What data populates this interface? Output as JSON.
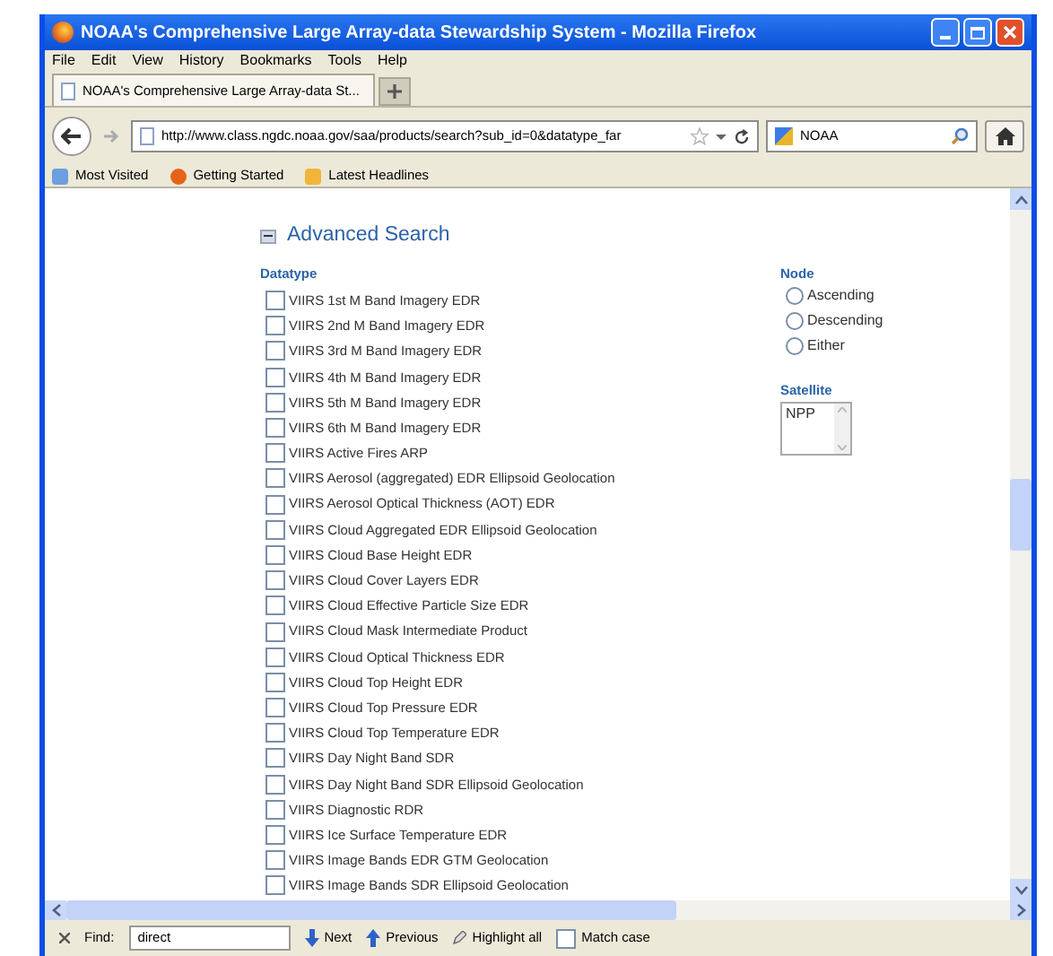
{
  "window": {
    "title": "NOAA's Comprehensive Large Array-data Stewardship System - Mozilla Firefox"
  },
  "menu": [
    "File",
    "Edit",
    "View",
    "History",
    "Bookmarks",
    "Tools",
    "Help"
  ],
  "tabs": [
    {
      "label": "NOAA's Comprehensive Large Array-data St...",
      "selected": true
    }
  ],
  "address": {
    "value": "http://www.class.ngdc.noaa.gov/saa/products/search?sub_id=0&datatype_far"
  },
  "search": {
    "value": "NOAA"
  },
  "bookmarks": [
    "Most Visited",
    "Getting Started",
    "Latest Headlines"
  ],
  "page": {
    "heading": "Advanced Search",
    "datatype": {
      "label": "Datatype",
      "items": [
        {
          "label": "VIIRS 1st M Band Imagery EDR",
          "checked": false
        },
        {
          "label": "VIIRS 2nd M Band Imagery EDR",
          "checked": false
        },
        {
          "label": "VIIRS 3rd M Band Imagery EDR",
          "checked": false
        },
        {
          "label": "VIIRS 4th M Band Imagery EDR",
          "checked": false
        },
        {
          "label": "VIIRS 5th M Band Imagery EDR",
          "checked": false
        },
        {
          "label": "VIIRS 6th M Band Imagery EDR",
          "checked": false
        },
        {
          "label": "VIIRS Active Fires ARP",
          "checked": false
        },
        {
          "label": "VIIRS Aerosol (aggregated) EDR Ellipsoid Geolocation",
          "checked": false
        },
        {
          "label": "VIIRS Aerosol Optical Thickness (AOT) EDR",
          "checked": false
        },
        {
          "label": "VIIRS Cloud Aggregated EDR Ellipsoid Geolocation",
          "checked": false
        },
        {
          "label": "VIIRS Cloud Base Height EDR",
          "checked": false
        },
        {
          "label": "VIIRS Cloud Cover Layers EDR",
          "checked": false
        },
        {
          "label": "VIIRS Cloud Effective Particle Size EDR",
          "checked": false
        },
        {
          "label": "VIIRS Cloud Mask Intermediate Product",
          "checked": false
        },
        {
          "label": "VIIRS Cloud Optical Thickness EDR",
          "checked": false
        },
        {
          "label": "VIIRS Cloud Top Height EDR",
          "checked": false
        },
        {
          "label": "VIIRS Cloud Top Pressure EDR",
          "checked": false
        },
        {
          "label": "VIIRS Cloud Top Temperature EDR",
          "checked": false
        },
        {
          "label": "VIIRS Day Night Band SDR",
          "checked": false
        },
        {
          "label": "VIIRS Day Night Band SDR Ellipsoid Geolocation",
          "checked": false
        },
        {
          "label": "VIIRS Diagnostic RDR",
          "checked": false
        },
        {
          "label": "VIIRS Ice Surface Temperature EDR",
          "checked": false
        },
        {
          "label": "VIIRS Image Bands EDR GTM Geolocation",
          "checked": false
        },
        {
          "label": "VIIRS Image Bands SDR Ellipsoid Geolocation",
          "checked": false
        }
      ]
    },
    "node": {
      "label": "Node",
      "options": [
        {
          "label": "Ascending",
          "selected": false
        },
        {
          "label": "Descending",
          "selected": false
        },
        {
          "label": "Either",
          "selected": false
        }
      ]
    },
    "satellite": {
      "label": "Satellite",
      "options": [
        "NPP"
      ]
    }
  },
  "find_bar": {
    "label": "Find:",
    "value": "direct",
    "buttons": [
      "Next",
      "Previous",
      "Highlight all"
    ],
    "match_case": {
      "label": "Match case",
      "checked": false
    }
  }
}
